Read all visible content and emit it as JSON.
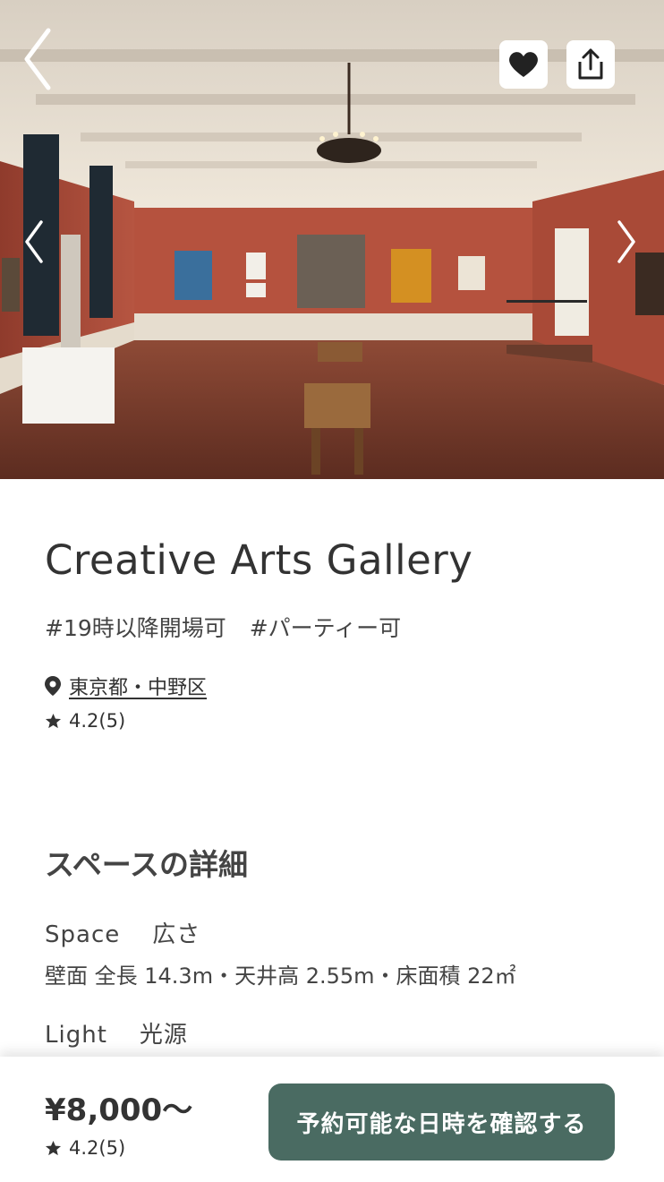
{
  "hero": {
    "photo_subject": "gallery-interior-photo",
    "back_icon": "chevron-left-icon",
    "favorite_icon": "heart-icon",
    "share_icon": "share-icon",
    "prev_icon": "chevron-left-icon",
    "next_icon": "chevron-right-icon"
  },
  "space": {
    "title": "Creative Arts Gallery",
    "tags": [
      "#19時以降開場可",
      "#パーティー可"
    ],
    "location": "東京都・中野区",
    "rating": "4.2(5)"
  },
  "details": {
    "section_title": "スペースの詳細",
    "space_label_en": "Space",
    "space_label_jp": "広さ",
    "space_value": "壁面 全長 14.3m・天井高 2.55m・床面積 22㎡",
    "light_label_en": "Light",
    "light_label_jp": "光源"
  },
  "bottom_bar": {
    "price": "¥8,000〜",
    "rating": "4.2(5)",
    "reserve_label": "予約可能な日時を確認する"
  },
  "colors": {
    "accent": "#4a6b62",
    "wall": "#b5523e",
    "floor": "#7a3e2c"
  }
}
